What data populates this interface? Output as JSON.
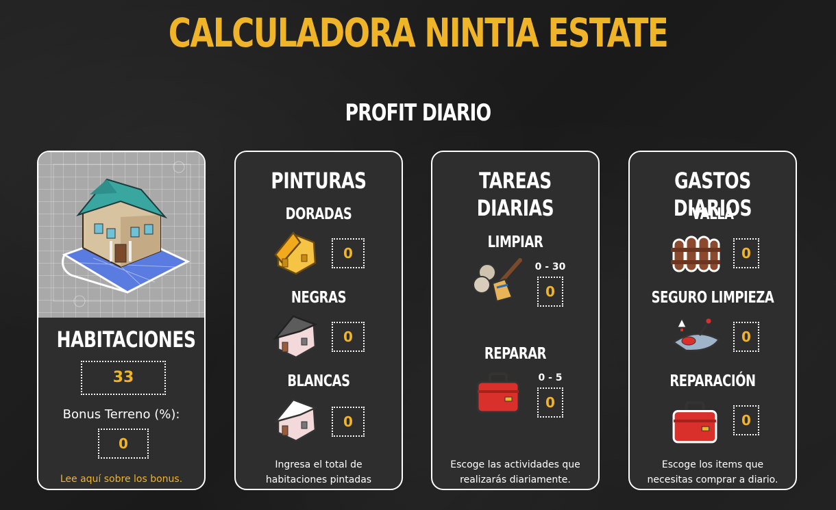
{
  "title": "CALCULADORA NINTIA ESTATE",
  "subtitle": "PROFIT DIARIO",
  "cards": {
    "habitaciones": {
      "heading": "HABITACIONES",
      "rooms_value": "33",
      "bonus_label": "Bonus Terreno (%):",
      "bonus_value": "0",
      "link": "Lee aquí sobre los bonus.",
      "hero_icon": "house-blueprint-icon"
    },
    "pinturas": {
      "heading": "PINTURAS",
      "items": [
        {
          "label": "DORADAS",
          "value": "0",
          "icon": "gold-house-icon"
        },
        {
          "label": "NEGRAS",
          "value": "0",
          "icon": "black-house-icon"
        },
        {
          "label": "BLANCAS",
          "value": "0",
          "icon": "white-house-icon"
        }
      ],
      "footer_line1": "Ingresa el total de",
      "footer_line2": "habitaciones pintadas"
    },
    "tareas": {
      "heading": "TAREAS DIARIAS",
      "items": [
        {
          "label": "LIMPIAR",
          "range": "0 - 30",
          "value": "0",
          "icon": "broom-icon"
        },
        {
          "label": "REPARAR",
          "range": "0 - 5",
          "value": "0",
          "icon": "toolbox-icon"
        }
      ],
      "footer_line1": "Escoge las actividades que",
      "footer_line2": "realizarás diariamente."
    },
    "gastos": {
      "heading": "GASTOS DIARIOS",
      "items": [
        {
          "label": "VALLA",
          "value": "0",
          "icon": "fence-icon"
        },
        {
          "label": "SEGURO LIMPIEZA",
          "value": "0",
          "icon": "robot-vacuum-icon"
        },
        {
          "label": "REPARACIÓN",
          "value": "0",
          "icon": "toolbox-icon"
        }
      ],
      "footer_line1": "Escoge los items que",
      "footer_line2": "necesitas comprar a diario."
    }
  },
  "colors": {
    "accent": "#f0b429",
    "card_bg": "#2e2e2e",
    "page_bg": "#1e1e1e",
    "border": "#ffffff"
  }
}
